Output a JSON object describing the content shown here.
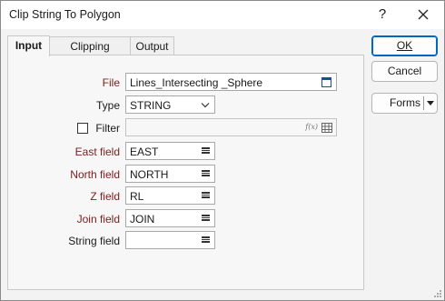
{
  "window": {
    "title": "Clip String To Polygon",
    "help_label": "?"
  },
  "tabs": [
    {
      "label": "Input"
    },
    {
      "label": "Clipping Polygon"
    },
    {
      "label": "Output"
    }
  ],
  "form": {
    "file": {
      "label": "File",
      "value": "Lines_Intersecting _Sphere"
    },
    "type": {
      "label": "Type",
      "value": "STRING"
    },
    "filter": {
      "label": "Filter",
      "checked": false,
      "value": "",
      "fx_label": "f(x)"
    },
    "east": {
      "label": "East field",
      "value": "EAST"
    },
    "north": {
      "label": "North field",
      "value": "NORTH"
    },
    "z": {
      "label": "Z field",
      "value": "RL"
    },
    "join": {
      "label": "Join field",
      "value": "JOIN"
    },
    "string": {
      "label": "String field",
      "value": ""
    }
  },
  "buttons": {
    "ok_label": "OK",
    "cancel_label": "Cancel",
    "forms_label": "Forms"
  },
  "colors": {
    "required_label": "#7b1c1c",
    "default_button_border": "#0067c0"
  }
}
